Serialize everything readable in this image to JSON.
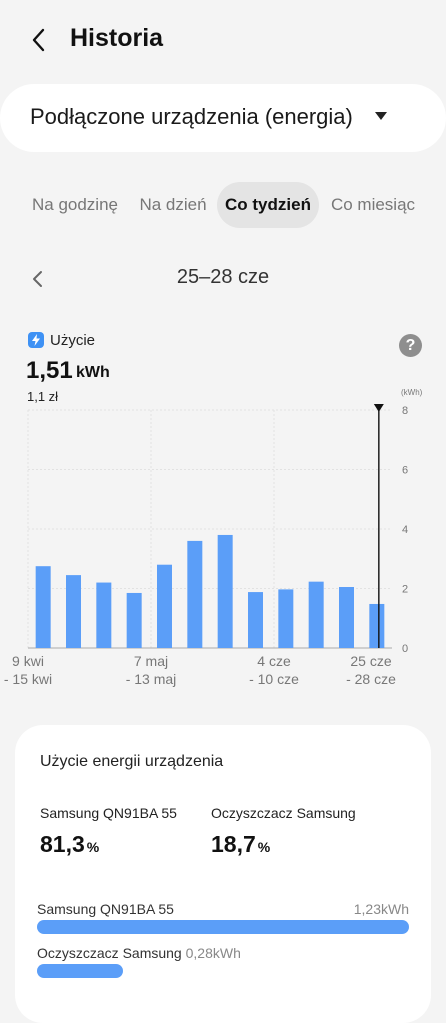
{
  "header": {
    "title": "Historia"
  },
  "device_selector": {
    "label": "Podłączone urządzenia (energia)"
  },
  "tabs": [
    {
      "label": "Na godzinę",
      "active": false
    },
    {
      "label": "Na dzień",
      "active": false
    },
    {
      "label": "Co tydzień",
      "active": true
    },
    {
      "label": "Co miesiąc",
      "active": false
    }
  ],
  "period": {
    "label": "25–28 cze"
  },
  "usage": {
    "label": "Użycie",
    "value": "1,51",
    "unit": "kWh",
    "cost": "1,1 zł",
    "help": "?"
  },
  "chart_data": {
    "type": "bar",
    "ylabel": "(kWh)",
    "ylim": [
      0,
      8
    ],
    "yticks": [
      "8",
      "6",
      "4",
      "2",
      "0"
    ],
    "xticks": [
      {
        "line1": "9 kwi",
        "line2": "- 15 kwi"
      },
      {
        "line1": "7 maj",
        "line2": "- 13 maj"
      },
      {
        "line1": "4 cze",
        "line2": "- 10 cze"
      },
      {
        "line1": "25 cze",
        "line2": "- 28 cze"
      }
    ],
    "values": [
      2.75,
      2.45,
      2.2,
      1.85,
      2.8,
      3.6,
      3.8,
      1.88,
      1.97,
      2.23,
      2.05,
      1.48
    ],
    "bar_color": "#5b9ef8",
    "selected_index": 11
  },
  "energy_card": {
    "title": "Użycie energii urządzenia",
    "devices": [
      {
        "name": "Samsung QN91BA 55",
        "percent": "81,3",
        "bar_value": "1,23kWh",
        "share": 1.0
      },
      {
        "name": "Oczyszczacz Samsung",
        "percent": "18,7",
        "bar_value": "0,28kWh",
        "share": 0.23
      }
    ],
    "percent_sign": "%"
  }
}
